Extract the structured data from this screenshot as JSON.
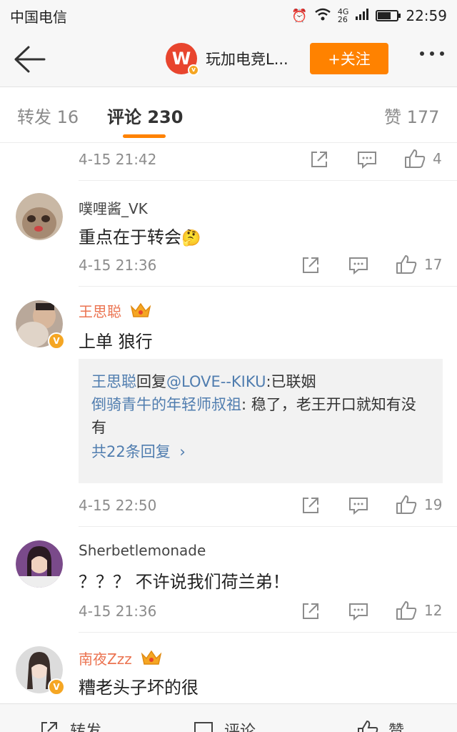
{
  "status_bar": {
    "carrier": "中国电信",
    "network": "4G 26",
    "time": "22:59",
    "battery_level": 0.7
  },
  "nav": {
    "account_name": "玩加电竞L...",
    "account_logo": "W",
    "follow_label": "+关注"
  },
  "tabs": [
    {
      "label": "转发 16"
    },
    {
      "label": "评论 230"
    },
    {
      "label": "赞 177"
    }
  ],
  "comments": [
    {
      "time": "4-15 21:42",
      "likes": "4"
    },
    {
      "user": "噗哩酱_VK",
      "text": "重点在于转会",
      "emoji": "🤔",
      "time": "4-15 21:36",
      "likes": "17"
    },
    {
      "user": "王思聪",
      "text": "上单 狼行",
      "time": "4-15 22:50",
      "likes": "19",
      "replies": [
        {
          "author": "王思聪",
          "verb": "回复",
          "mention": "@LOVE--KIKU",
          "content": ":已联姻"
        },
        {
          "author": "倒骑青牛的年轻师叔祖",
          "content": ": 稳了，老王开口就知有没有"
        }
      ],
      "reply_count_label": "共22条回复"
    },
    {
      "user": "Sherbetlemonade",
      "text": "？？？ 不许说我们荷兰弟！",
      "time": "4-15 21:36",
      "likes": "12"
    },
    {
      "user": "南夜Zzz",
      "text": "糟老头子坏的很"
    }
  ],
  "bottom": {
    "repost": "转发",
    "comment": "评论",
    "like": "赞"
  },
  "colors": {
    "accent": "#ff8200",
    "link": "#507daf",
    "vip_name": "#eb7350"
  }
}
